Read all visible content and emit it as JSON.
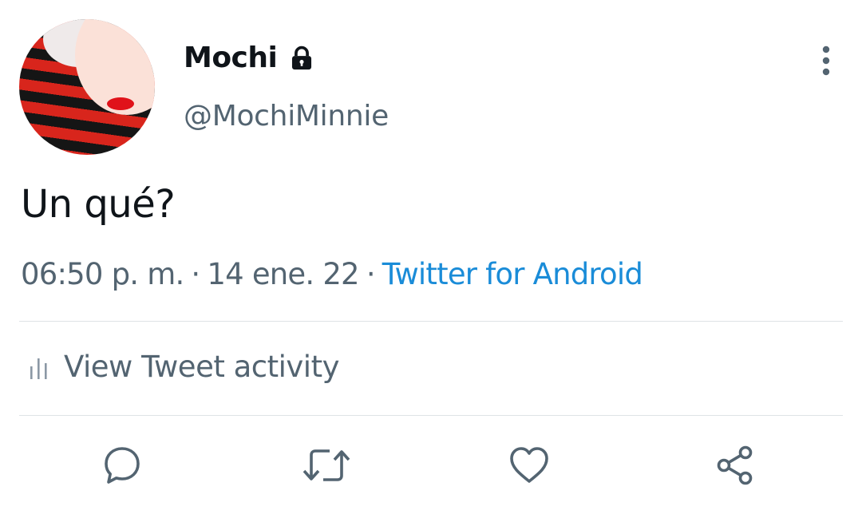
{
  "author": {
    "display_name": "Mochi",
    "handle": "@MochiMinnie",
    "protected_icon": "lock-icon",
    "avatar": "profile-photo"
  },
  "tweet": {
    "text": "Un qué?",
    "time": "06:50 p. m.",
    "separator": "·",
    "date": "14 ene. 22",
    "source": "Twitter for Android"
  },
  "activity": {
    "label": "View Tweet activity",
    "icon": "bar-chart-icon"
  },
  "actions": {
    "reply_icon": "reply-icon",
    "retweet_icon": "retweet-icon",
    "like_icon": "heart-icon",
    "share_icon": "share-icon"
  },
  "colors": {
    "text": "#0f1419",
    "secondary": "#536471",
    "link": "#1a8cd8",
    "divider": "#dfe3e6"
  }
}
